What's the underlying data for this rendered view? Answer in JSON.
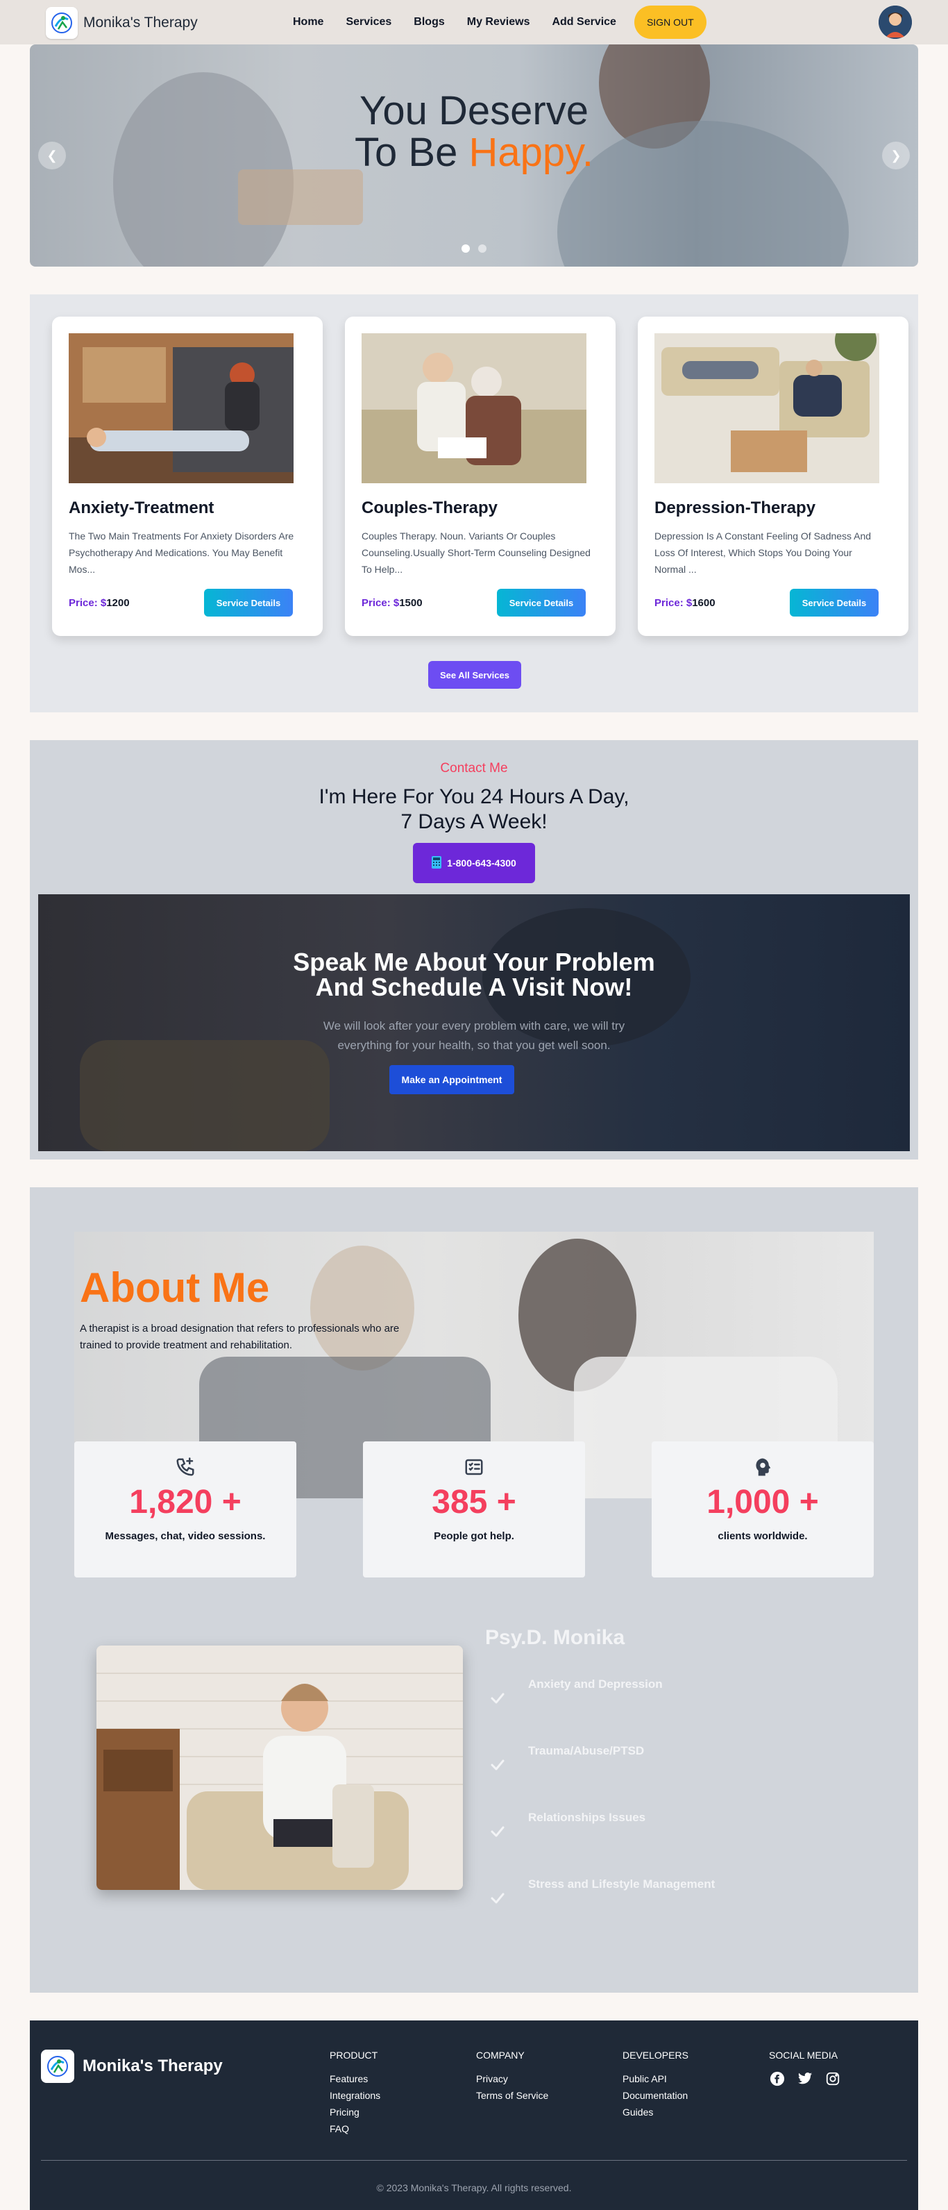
{
  "nav": {
    "brand": "Monika's Therapy",
    "links": [
      "Home",
      "Services",
      "Blogs",
      "My Reviews",
      "Add Service"
    ],
    "signout_label": "SIGN OUT"
  },
  "hero": {
    "line1": "You Deserve",
    "line2_prefix": "To Be ",
    "line2_highlight": "Happy.",
    "prev_icon": "chevron-left-icon",
    "next_icon": "chevron-right-icon",
    "slides": 2,
    "active_slide": 1
  },
  "services": {
    "cards": [
      {
        "title": "Anxiety-Treatment",
        "description": "The Two Main Treatments For Anxiety Disorders Are Psychotherapy And Medications. You May Benefit Mos...",
        "price_label": "Price: $",
        "price": "1200",
        "button": "Service Details"
      },
      {
        "title": "Couples-Therapy",
        "description": "Couples Therapy. Noun. Variants Or Couples Counseling.Usually Short-Term Counseling Designed To Help...",
        "price_label": "Price: $",
        "price": "1500",
        "button": "Service Details"
      },
      {
        "title": "Depression-Therapy",
        "description": "Depression Is A Constant Feeling Of Sadness And Loss Of Interest, Which Stops You Doing Your Normal ...",
        "price_label": "Price: $",
        "price": "1600",
        "button": "Service Details"
      }
    ],
    "see_all": "See All Services"
  },
  "contact": {
    "kicker": "Contact Me",
    "title_line1": "I'm Here For You 24 Hours A Day,",
    "title_line2": "7 Days A Week!",
    "phone": "1-800-643-4300",
    "promo_title_line1": "Speak Me About Your Problem",
    "promo_title_line2": "And Schedule A Visit Now!",
    "promo_text_line1": "We will look after your every problem with care, we will try",
    "promo_text_line2": "everything for your health, so that you get well soon.",
    "appointment_button": "Make an Appointment"
  },
  "about": {
    "title": "About Me",
    "description": "A therapist is a broad designation that refers to professionals who are trained to provide treatment and rehabilitation.",
    "stats": [
      {
        "icon": "phone-plus-icon",
        "value": "1,820 +",
        "label": "Messages, chat, video sessions."
      },
      {
        "icon": "checklist-icon",
        "value": "385 +",
        "label": "People got help."
      },
      {
        "icon": "head-brain-icon",
        "value": "1,000 +",
        "label": "clients worldwide."
      }
    ],
    "doctor_name": "Psy.D. Monika",
    "specialties": [
      "Anxiety and Depression",
      "Trauma/Abuse/PTSD",
      "Relationships Issues",
      "Stress and Lifestyle Management"
    ]
  },
  "footer": {
    "brand": "Monika's Therapy",
    "columns": [
      {
        "heading": "PRODUCT",
        "links": [
          "Features",
          "Integrations",
          "Pricing",
          "FAQ"
        ]
      },
      {
        "heading": "COMPANY",
        "links": [
          "Privacy",
          "Terms of Service"
        ]
      },
      {
        "heading": "DEVELOPERS",
        "links": [
          "Public API",
          "Documentation",
          "Guides"
        ]
      }
    ],
    "social_heading": "SOCIAL MEDIA",
    "social_icons": [
      "facebook-icon",
      "twitter-icon",
      "instagram-icon"
    ],
    "copyright": "© 2023 Monika's Therapy. All rights reserved."
  },
  "colors": {
    "accent_orange": "#f97316",
    "accent_rose": "#f43f5e",
    "signout_yellow": "#fbbf24",
    "purple": "#6d28d9"
  }
}
